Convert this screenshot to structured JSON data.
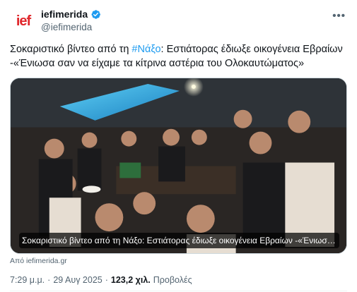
{
  "account": {
    "display_name": "iefimerida",
    "handle": "@iefimerida",
    "avatar_text": "ief",
    "verified": true,
    "more_icon": "more-horizontal-icon"
  },
  "tweet": {
    "text_before": "Σοκαριστικό βίντεο από τη ",
    "hashtag": "#Νάξο",
    "text_after": ": Εστιάτορας έδιωξε οικογένεια Εβραίων -«Ένιωσα σαν να είχαμε τα κίτρινα αστέρια του Ολοκαυτώματος»"
  },
  "card": {
    "caption": "Σοκαριστικό βίντεο από τη Νάξο: Εστιάτορας έδιωξε οικογένεια Εβραίων -«Ένιωσα σα...",
    "source": "Από iefimerida.gr"
  },
  "meta": {
    "time": "7:29 μ.μ.",
    "separator": "·",
    "date": "29 Αυγ 2025",
    "views_count": "123,2 χιλ.",
    "views_label": "Προβολές"
  },
  "colors": {
    "accent": "#1d9bf0",
    "brand": "#e0262b",
    "text": "#0f1419",
    "secondary": "#536471"
  }
}
